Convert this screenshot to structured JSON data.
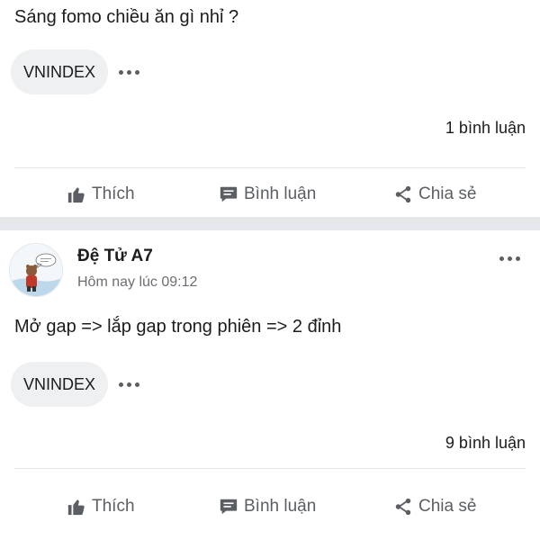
{
  "posts": [
    {
      "text": "Sáng fomo chiều ăn gì nhỉ ?",
      "tag": "VNINDEX",
      "comment_count": "1 bình luận",
      "actions": {
        "like": "Thích",
        "comment": "Bình luận",
        "share": "Chia sẻ"
      }
    },
    {
      "author": {
        "name": "Đệ Tử A7",
        "time": "Hôm nay lúc 09:12"
      },
      "text": "Mở gap => lắp gap trong phiên => 2 đỉnh",
      "tag": "VNINDEX",
      "comment_count": "9 bình luận",
      "actions": {
        "like": "Thích",
        "comment": "Bình luận",
        "share": "Chia sẻ"
      }
    }
  ],
  "icons": {
    "more": "more-horizontal-icon",
    "like": "thumbs-up-icon",
    "comment": "chat-bubble-icon",
    "share": "share-icon"
  },
  "colors": {
    "text": "#1c1c1e",
    "muted": "#5b5e63",
    "chip_bg": "#eef0f2",
    "separator": "#e6e7ea"
  }
}
